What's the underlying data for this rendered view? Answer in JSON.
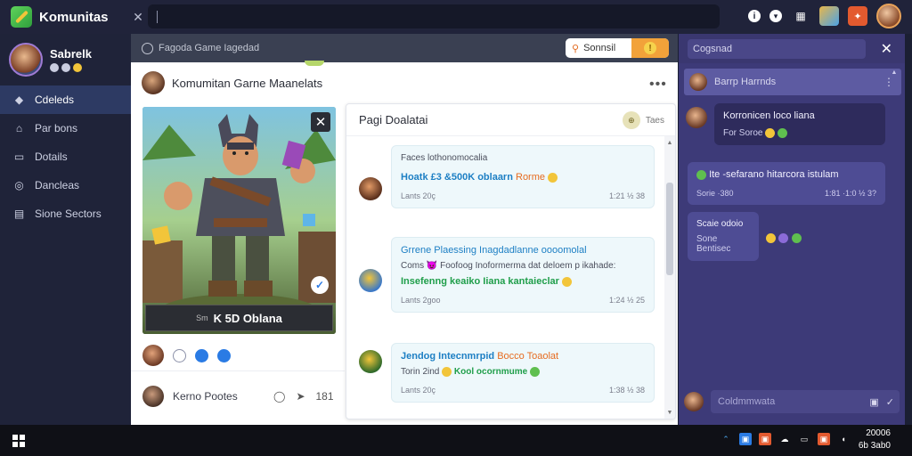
{
  "app": {
    "title": "Komunitas"
  },
  "topbar": {
    "tab_close": "✕"
  },
  "sidebar": {
    "profile": {
      "name": "Sabrelk"
    },
    "items": [
      {
        "label": "Cdeleds",
        "icon": "tag-icon"
      },
      {
        "label": "Par bons",
        "icon": "home-icon"
      },
      {
        "label": "Dotails",
        "icon": "monitor-icon"
      },
      {
        "label": "Dancleas",
        "icon": "globe-icon"
      },
      {
        "label": "Sione Sectors",
        "icon": "grid-icon"
      }
    ]
  },
  "main": {
    "top_label": "Fagoda Game Iagedad",
    "search_chip": "Sonnsil",
    "post_title": "Komumitan Garne Maanelats",
    "post_menu": "•••",
    "game_card": {
      "caption_small": "Sm",
      "caption_big": "K 5D Oblana"
    },
    "comment": {
      "text": "Kerno Pootes",
      "count": "181"
    }
  },
  "inner": {
    "title": "Pagi Doalatai",
    "head_right": "Taes",
    "messages": [
      {
        "line1": "Faces lothonomocalia",
        "link": "Hoatk £3 &500K oblaarn",
        "link_extra": "Rorme",
        "meta_left": "Lants 20ç",
        "meta_right": "1:21 ½ 38"
      },
      {
        "link": "Grrene Plaessing Inagdadlanne oooomolal",
        "plain": "Coms 😈 Foofoog Inoformerma dat deloem p ikahade:",
        "link_green": "Insefenng keaiko Iiana kantaieclar",
        "meta_left": "Lants 2goo",
        "meta_right": "1:24 ½ 25"
      },
      {
        "link": "Jendog Intecnmrpid",
        "link_extra": "Bocco Toaolat",
        "plain": "Torin 2ind",
        "link_green": "Kool ocornmume",
        "meta_left": "Lants 20ç",
        "meta_right": "1:38 ½ 38"
      }
    ]
  },
  "chat": {
    "search": "Cogsnad",
    "close": "✕",
    "pinned": "Barrp Harrnds",
    "messages": [
      {
        "title": "Korronicen loco liana",
        "sub": "For Soroe"
      },
      {
        "title": "Ite -sefarano hitarcora istulam",
        "row_left": "Sorie ·380",
        "row_right": "1:81 ·1:0 ½ 3?"
      },
      {
        "title": "Scaie odoio",
        "sub": "Sone Bentisec"
      }
    ],
    "input_placeholder": "Coldmmwata"
  },
  "taskbar": {
    "clock_time": "20006",
    "clock_date": "6b 3ab0"
  }
}
